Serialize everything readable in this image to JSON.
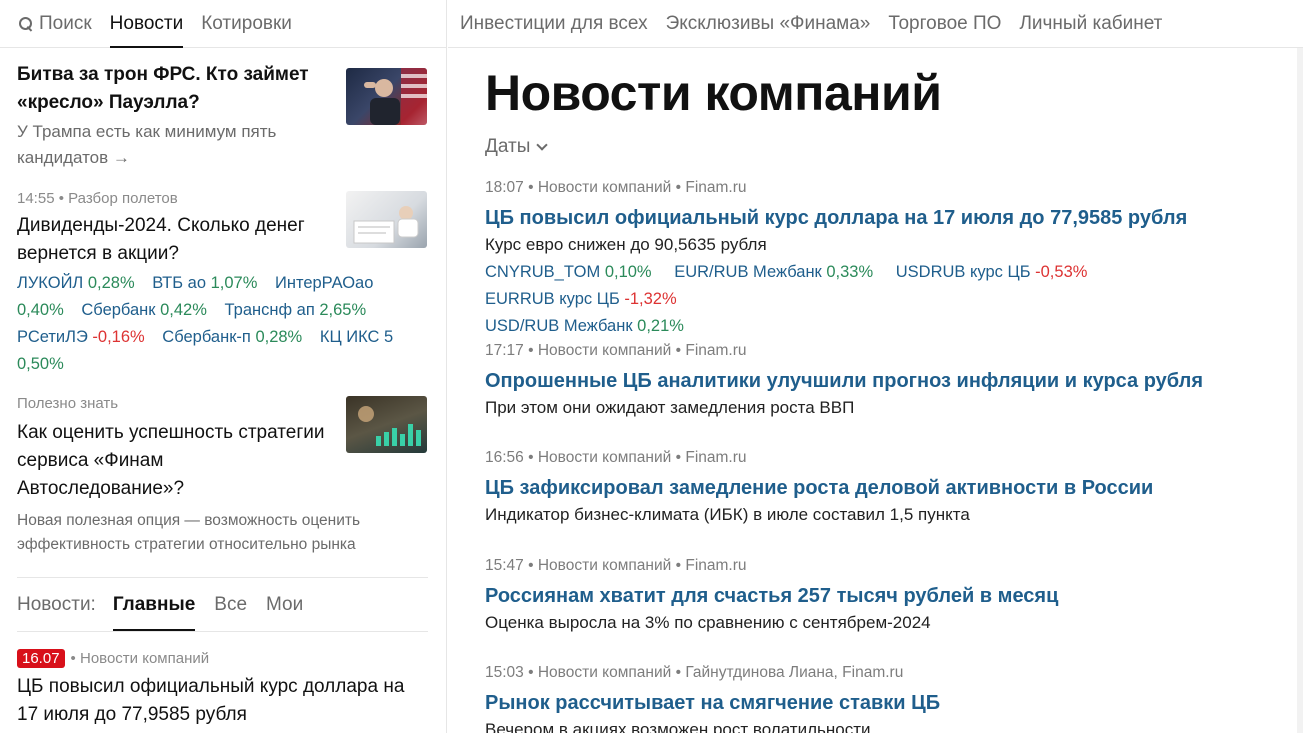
{
  "left_nav": {
    "search": "Поиск",
    "news": "Новости",
    "quotes": "Котировки"
  },
  "top_nav": [
    "Инвестиции для всех",
    "Эксклюзивы «Финама»",
    "Торговое ПО",
    "Личный кабинет"
  ],
  "featured": [
    {
      "title": "Битва за трон ФРС. Кто займет «кресло» Пауэлла?",
      "subtitle": "У Трампа есть как минимум пять кандидатов",
      "arrow": "→"
    },
    {
      "time": "14:55",
      "category": "Разбор полетов",
      "title": "Дивиденды-2024. Сколько денег вернется в акции?",
      "tickers": [
        {
          "name": "ЛУКОЙЛ",
          "change": "0,28%",
          "dir": "up"
        },
        {
          "name": "ВТБ ао",
          "change": "1,07%",
          "dir": "up"
        },
        {
          "name": "ИнтерРАОао",
          "change": "0,40%",
          "dir": "up"
        },
        {
          "name": "Сбербанк",
          "change": "0,42%",
          "dir": "up"
        },
        {
          "name": "Транснф ап",
          "change": "2,65%",
          "dir": "up"
        },
        {
          "name": "РСетиЛЭ",
          "change": "-0,16%",
          "dir": "down"
        },
        {
          "name": "Сбербанк-п",
          "change": "0,28%",
          "dir": "up"
        },
        {
          "name": "КЦ ИКС 5",
          "change": "0,50%",
          "dir": "up"
        }
      ]
    },
    {
      "category": "Полезно знать",
      "title": "Как оценить успешность стратегии сервиса «Финам Автоследование»?",
      "description": "Новая полезная опция — возможность оценить эффективность стратегии относительно рынка"
    }
  ],
  "feed_tabs": {
    "label": "Новости:",
    "main": "Главные",
    "all": "Все",
    "mine": "Мои"
  },
  "feed_item": {
    "date": "16.07",
    "category": "Новости компаний",
    "title": "ЦБ повысил официальный курс доллара на 17 июля до 77,9585 рубля"
  },
  "page_title": "Новости компаний",
  "dates_filter": "Даты",
  "news": [
    {
      "time": "18:07",
      "category": "Новости компаний",
      "source": "Finam.ru",
      "headline": "ЦБ повысил официальный курс доллара на 17 июля до 77,9585 рубля",
      "lead": "Курс евро снижен до 90,5635 рубля",
      "tickers": [
        {
          "name": "CNYRUB_TOM",
          "change": "0,10%",
          "dir": "up"
        },
        {
          "name": "EUR/RUB Межбанк",
          "change": "0,33%",
          "dir": "up"
        },
        {
          "name": "USDRUB курс ЦБ",
          "change": "-0,53%",
          "dir": "down"
        },
        {
          "name": "EURRUB курс ЦБ",
          "change": "-1,32%",
          "dir": "down"
        },
        {
          "name": "USD/RUB Межбанк",
          "change": "0,21%",
          "dir": "up"
        }
      ]
    },
    {
      "time": "17:17",
      "category": "Новости компаний",
      "source": "Finam.ru",
      "headline": "Опрошенные ЦБ аналитики улучшили прогноз инфляции и курса рубля",
      "lead": "При этом они ожидают замедления роста ВВП"
    },
    {
      "time": "16:56",
      "category": "Новости компаний",
      "source": "Finam.ru",
      "headline": "ЦБ зафиксировал замедление роста деловой активности в России",
      "lead": "Индикатор бизнес-климата (ИБК) в июле составил 1,5 пункта"
    },
    {
      "time": "15:47",
      "category": "Новости компаний",
      "source": "Finam.ru",
      "headline": "Россиянам хватит для счастья 257 тысяч рублей в месяц",
      "lead": "Оценка выросла на 3% по сравнению с сентябрем-2024"
    },
    {
      "time": "15:03",
      "category": "Новости компаний",
      "source": "Гайнутдинова Лиана, Finam.ru",
      "headline": "Рынок рассчитывает на смягчение ставки ЦБ",
      "lead": "Вечером в акциях возможен рост волатильности"
    }
  ],
  "colors": {
    "link": "#1f5e8c",
    "up": "#2b8a5a",
    "down": "#dd3333",
    "badge": "#d8101a"
  },
  "separator": "•"
}
